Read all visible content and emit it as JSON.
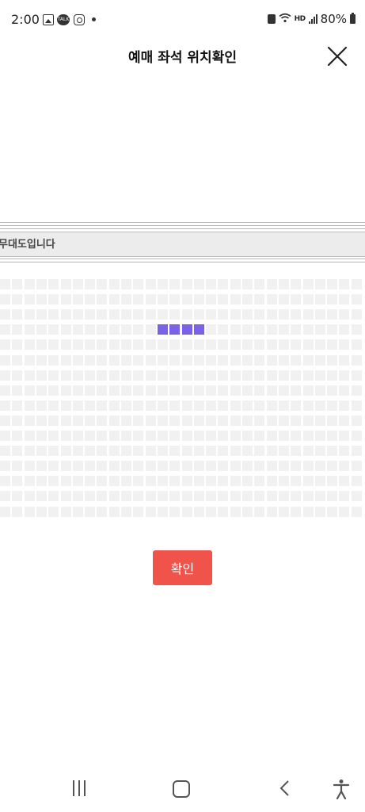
{
  "status_bar": {
    "time": "2:00",
    "talk_badge": "TALK",
    "hd_label": "HD",
    "battery": "80%",
    "icons": [
      "gallery-icon",
      "kakaotalk-icon",
      "instagram-icon",
      "notification-dot-icon",
      "lock-icon",
      "wifi-icon",
      "hd-voice-icon",
      "signal-icon",
      "battery-icon"
    ]
  },
  "header": {
    "title": "예매 좌석 위치확인",
    "close_icon": "close-icon"
  },
  "stage": {
    "label": "무대도입니다"
  },
  "seat_map": {
    "rows": 16,
    "cols": 30,
    "seat_color": "#f1f1f1",
    "selected_color": "#7b61e8",
    "selected_seats": [
      {
        "row": 3,
        "col": 13
      },
      {
        "row": 3,
        "col": 14
      },
      {
        "row": 3,
        "col": 15
      },
      {
        "row": 3,
        "col": 16
      }
    ]
  },
  "confirm_button": {
    "label": "확인",
    "color": "#f0534a"
  },
  "nav_bar": {
    "icons": [
      "recent-apps-icon",
      "home-icon",
      "back-icon",
      "accessibility-icon"
    ]
  }
}
